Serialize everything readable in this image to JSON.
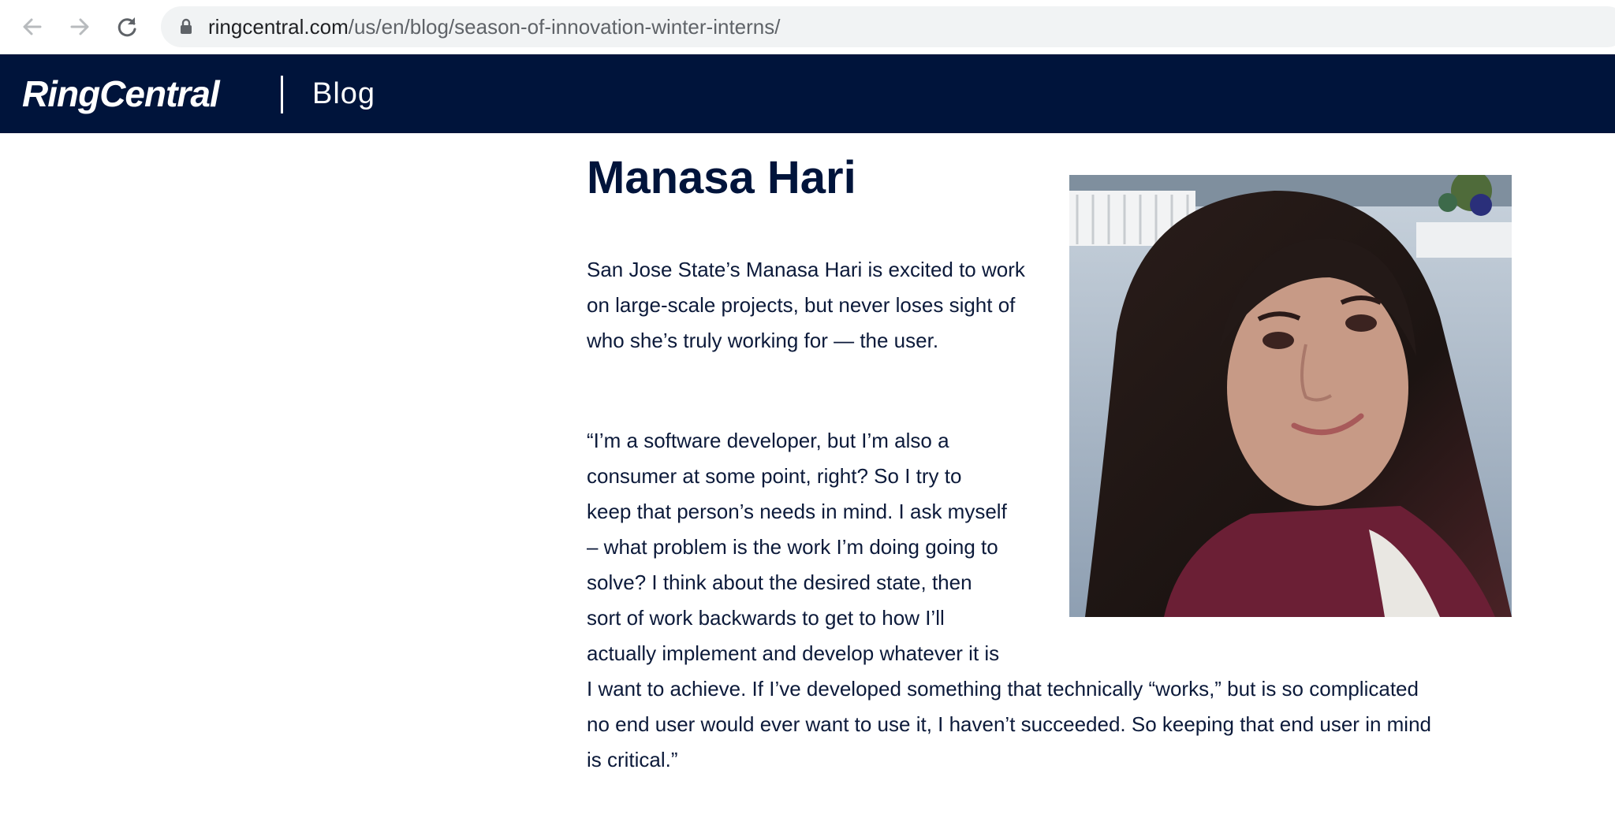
{
  "browser": {
    "url_domain": "ringcentral.com",
    "url_path": "/us/en/blog/season-of-innovation-winter-interns/"
  },
  "header": {
    "logo_text": "RingCentral",
    "section_label": "Blog"
  },
  "article": {
    "author_name": "Manasa Hari",
    "paragraph_1": "San Jose State’s Manasa Hari is excited to work on large-scale projects, but never loses sight of who she’s truly working for — the user.",
    "lines_2": [
      "“I’m a software developer, but I’m also a",
      "consumer at some point, right? So I try to",
      "keep that person’s needs in mind. I ask myself",
      "– what problem is the work I’m doing going to",
      "solve? I think about the desired state, then",
      "sort of work backwards to get to how I’ll",
      "actually implement and develop whatever it is",
      "I want to achieve. If I’ve developed something that technically “works,” but is so complicated",
      "no end user would ever want to use it, I haven’t succeeded. So keeping that end user in mind",
      "is critical.”"
    ]
  },
  "icons": {
    "back": "arrow-left-icon",
    "forward": "arrow-right-icon",
    "reload": "reload-icon",
    "lock": "lock-icon"
  },
  "colors": {
    "header_bg": "#00143b",
    "heading_text": "#00143b",
    "body_text": "#0c1a3a",
    "omnibox_bg": "#f1f3f4"
  }
}
